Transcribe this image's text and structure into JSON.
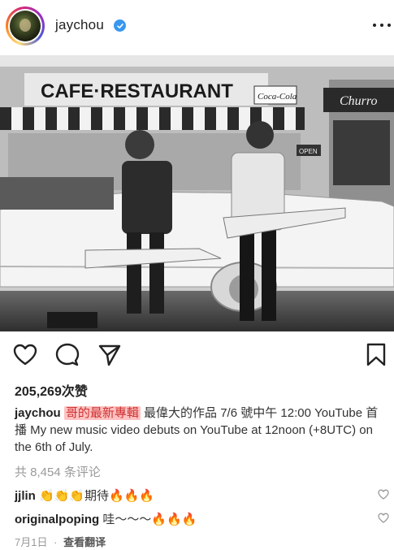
{
  "post": {
    "username": "jaychou",
    "likes": "205,269次赞",
    "caption_user": "jaychou",
    "caption_highlight": "哥的最新專輯",
    "caption_rest": "最偉大的作品 7/6 號中午 12:00 YouTube 首播 My new music video debuts on YouTube at 12noon (+8UTC) on the 6th of July.",
    "comments_link": "共 8,454 条评论",
    "comments": [
      {
        "user": "jjlin",
        "text": "👏👏👏期待🔥🔥🔥"
      },
      {
        "user": "originalpoping",
        "text": "哇～～～🔥🔥🔥"
      }
    ],
    "date": "7月1日",
    "separator": "·",
    "translate": "查看翻译"
  },
  "photo": {
    "sign_main": "CAFE·RESTAURANT",
    "sign_left": "Coca-Cola",
    "sign_right": "Churro",
    "open_sign": "OPEN"
  },
  "icons": {
    "verified": "verified-badge-icon",
    "more": "more-options-icon",
    "like": "heart-icon",
    "comment": "comment-icon",
    "share": "paper-plane-icon",
    "save": "bookmark-icon"
  },
  "colors": {
    "verified": "#3897f0",
    "highlight": "#ff7878"
  }
}
